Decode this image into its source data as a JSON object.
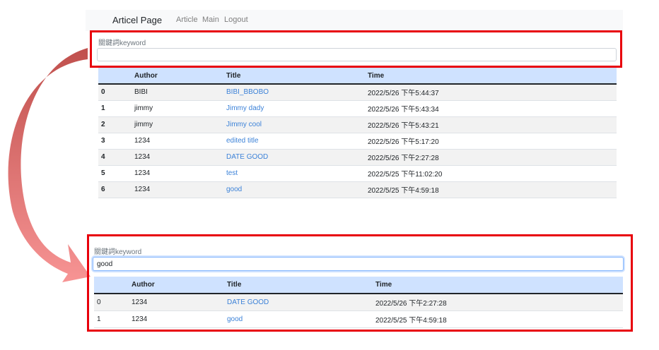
{
  "navbar": {
    "brand": "Articel Page",
    "links": [
      "Article",
      "Main",
      "Logout"
    ]
  },
  "search_top": {
    "label": "關鍵詞keyword",
    "value": ""
  },
  "table_top": {
    "headers": [
      "",
      "Author",
      "Title",
      "Time"
    ],
    "rows": [
      {
        "idx": "0",
        "author": "BIBI",
        "title": "BIBI_BBOBO",
        "time": "2022/5/26 下午5:44:37"
      },
      {
        "idx": "1",
        "author": "jimmy",
        "title": "Jimmy dady",
        "time": "2022/5/26 下午5:43:34"
      },
      {
        "idx": "2",
        "author": "jimmy",
        "title": "Jimmy cool",
        "time": "2022/5/26 下午5:43:21"
      },
      {
        "idx": "3",
        "author": "1234",
        "title": "edited title",
        "time": "2022/5/26 下午5:17:20"
      },
      {
        "idx": "4",
        "author": "1234",
        "title": "DATE GOOD",
        "time": "2022/5/26 下午2:27:28"
      },
      {
        "idx": "5",
        "author": "1234",
        "title": "test",
        "time": "2022/5/25 下午11:02:20"
      },
      {
        "idx": "6",
        "author": "1234",
        "title": "good",
        "time": "2022/5/25 下午4:59:18"
      }
    ]
  },
  "search_bottom": {
    "label": "關鍵詞keyword",
    "value": "good"
  },
  "table_bottom": {
    "headers": [
      "",
      "Author",
      "Title",
      "Time"
    ],
    "rows": [
      {
        "idx": "0",
        "author": "1234",
        "title": "DATE GOOD",
        "time": "2022/5/26 下午2:27:28"
      },
      {
        "idx": "1",
        "author": "1234",
        "title": "good",
        "time": "2022/5/25 下午4:59:18"
      }
    ]
  },
  "colors": {
    "highlight": "#e8000b",
    "header_bg": "#cfe2ff",
    "link": "#3c82d8",
    "arrow_start": "#c0392b",
    "arrow_end": "#f7a0a0"
  }
}
